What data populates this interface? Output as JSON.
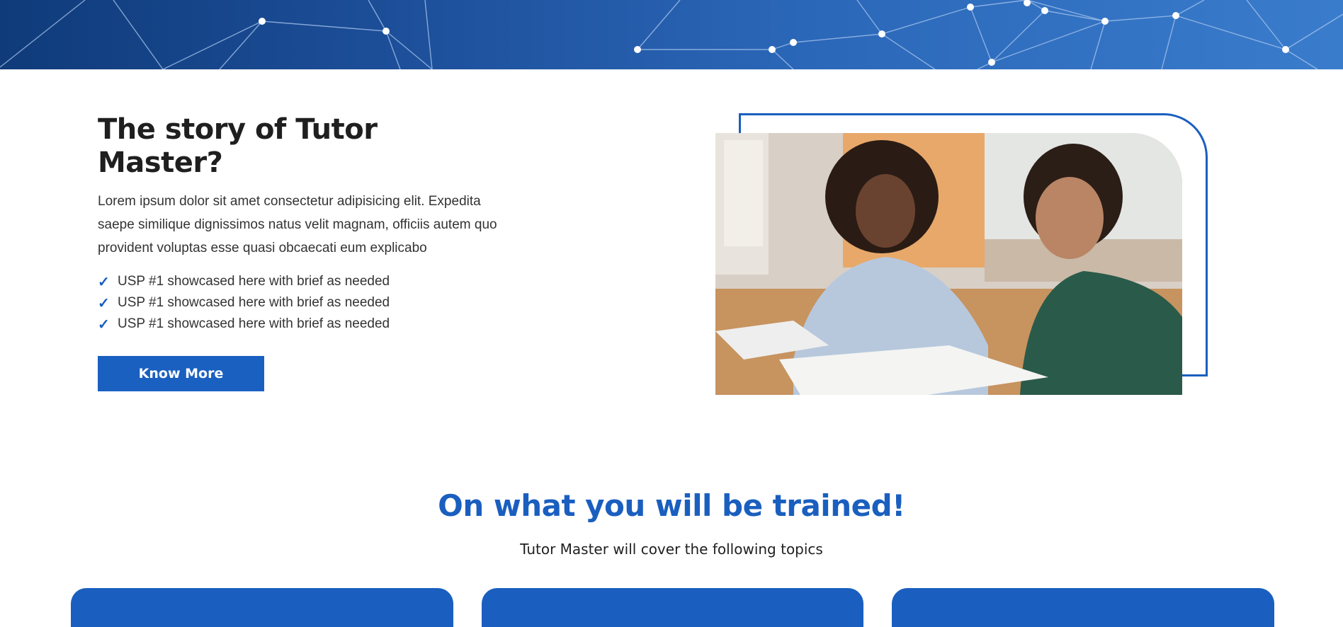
{
  "story": {
    "title": "The story of Tutor Master?",
    "text": "Lorem ipsum dolor sit amet consectetur adipisicing elit. Expedita saepe similique dignissimos natus velit magnam, officiis autem quo provident voluptas esse quasi obcaecati eum explicabo",
    "usps": [
      "USP #1 showcased here with brief as needed",
      "USP #1 showcased here with brief as needed",
      "USP #1 showcased here with brief as needed"
    ],
    "check_icon": "✓",
    "button_label": "Know More"
  },
  "training": {
    "title": "On what you will be trained!",
    "subtitle": "Tutor Master will cover the following topics"
  },
  "colors": {
    "brand": "#1a60c0",
    "hero_dark": "#0f3b7a",
    "hero_light": "#3a7ccc"
  },
  "icons": {
    "check": "check-icon",
    "hero_pattern": "network-pattern",
    "photo": "tutor-student-photo"
  }
}
